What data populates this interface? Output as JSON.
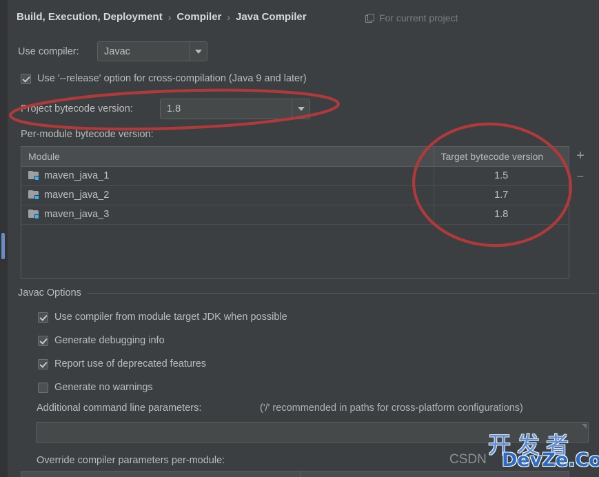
{
  "header": {
    "breadcrumb": [
      "Build, Execution, Deployment",
      "Compiler",
      "Java Compiler"
    ],
    "separator": "›",
    "scope_label": "For current project",
    "scope_icon": "copy-icon"
  },
  "compiler": {
    "use_compiler_label": "Use compiler:",
    "use_compiler_value": "Javac",
    "release_option_label": "Use '--release' option for cross-compilation (Java 9 and later)",
    "release_option_checked": true,
    "project_bytecode_label": "Project bytecode version:",
    "project_bytecode_value": "1.8",
    "per_module_label": "Per-module bytecode version:"
  },
  "module_table": {
    "columns": [
      "Module",
      "Target bytecode version"
    ],
    "rows": [
      {
        "module": "maven_java_1",
        "target": "1.5",
        "icon": "module-folder-icon"
      },
      {
        "module": "maven_java_2",
        "target": "1.7",
        "icon": "module-folder-icon"
      },
      {
        "module": "maven_java_3",
        "target": "1.8",
        "icon": "module-folder-icon"
      }
    ],
    "add_button": "+",
    "remove_button": "–"
  },
  "javac_options": {
    "group_title": "Javac Options",
    "checkboxes": [
      {
        "label": "Use compiler from module target JDK when possible",
        "checked": true
      },
      {
        "label": "Generate debugging info",
        "checked": true
      },
      {
        "label": "Report use of deprecated features",
        "checked": true
      },
      {
        "label": "Generate no warnings",
        "checked": false
      }
    ],
    "additional_params_label": "Additional command line parameters:",
    "additional_params_hint": "('/' recommended in paths for cross-platform configurations)",
    "additional_params_value": "",
    "override_label": "Override compiler parameters per-module:"
  },
  "annotations": {
    "accent_color": "#b03a3a",
    "circle_1_target": "project-bytecode-version-row",
    "circle_2_target": "target-bytecode-version-column"
  },
  "watermark": {
    "cn_text": "开发者",
    "csdn_text": "CSDN",
    "site_text": "DevZe.CoM"
  }
}
